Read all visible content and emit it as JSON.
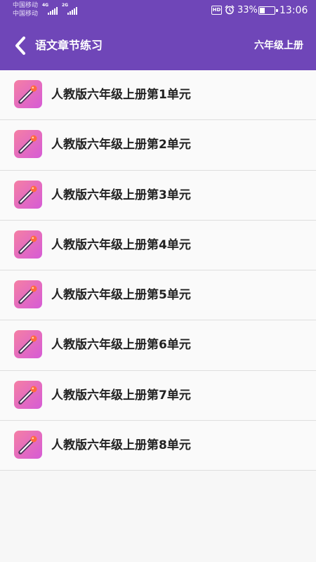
{
  "status_bar": {
    "carrier_1": "中国移动",
    "carrier_2": "中国移动",
    "net_1": "4G",
    "net_2": "2G",
    "hd_badge": "HD",
    "battery_percent": "33%",
    "time": "13:06"
  },
  "header": {
    "title": "语文章节练习",
    "grade": "六年级上册"
  },
  "colors": {
    "header_bg": "#6f46b8",
    "list_bg": "#fafafa",
    "icon_gradient_start": "#f57fa4",
    "icon_gradient_end": "#d65bd6"
  },
  "icons": {
    "back": "chevron-left-icon",
    "item": "pen-icon",
    "alarm": "alarm-clock-icon",
    "battery": "battery-icon"
  },
  "chapters": [
    {
      "label": "人教版六年级上册第1单元"
    },
    {
      "label": "人教版六年级上册第2单元"
    },
    {
      "label": "人教版六年级上册第3单元"
    },
    {
      "label": "人教版六年级上册第4单元"
    },
    {
      "label": "人教版六年级上册第5单元"
    },
    {
      "label": "人教版六年级上册第6单元"
    },
    {
      "label": "人教版六年级上册第7单元"
    },
    {
      "label": "人教版六年级上册第8单元"
    }
  ]
}
